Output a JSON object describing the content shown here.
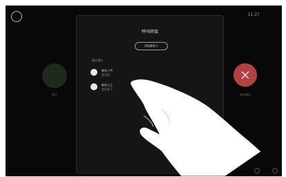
{
  "status_bar": {
    "time": "11:27"
  },
  "background": {
    "mute_label": "静音",
    "end_label": "结束通话"
  },
  "dialog": {
    "title": "呼叫转接",
    "pill_label": "添加联系人",
    "section_label": "最近通话",
    "options": [
      {
        "main": "联系人甲",
        "sub": "会议室"
      },
      {
        "main": "联系人乙",
        "sub": "会议室 2"
      }
    ]
  }
}
